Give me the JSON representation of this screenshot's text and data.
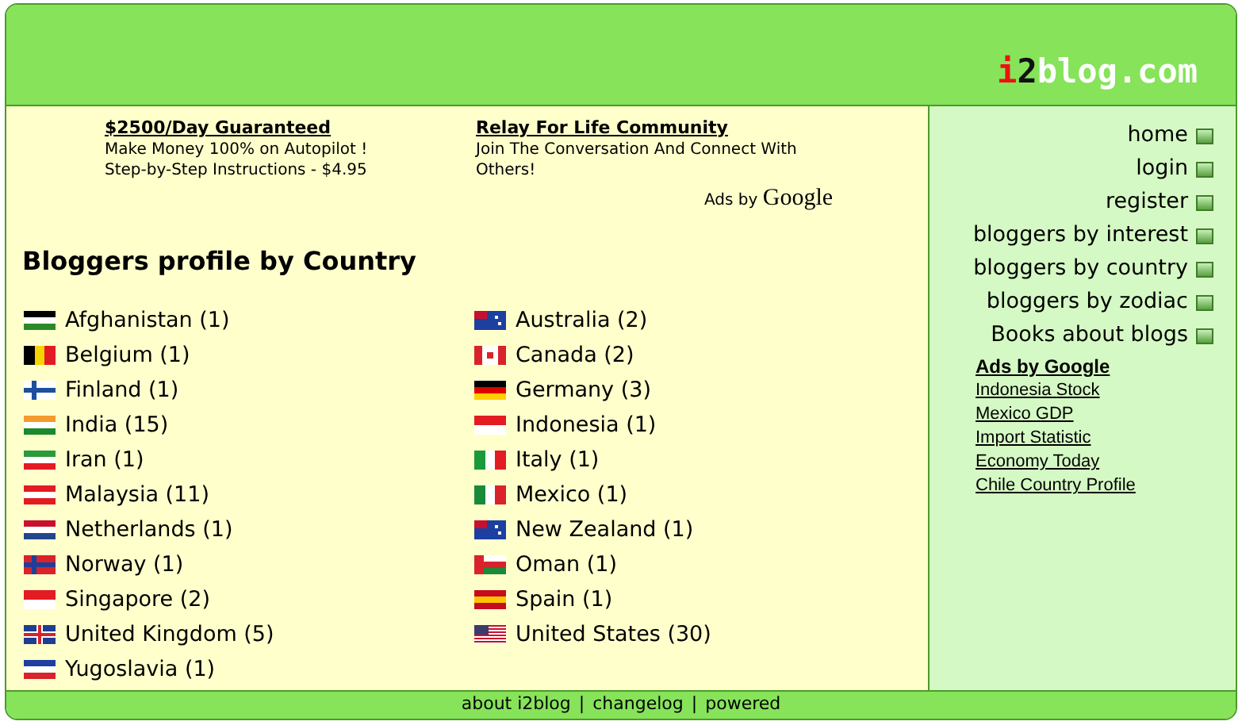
{
  "logo": {
    "parts": [
      {
        "text": "i",
        "color": "#ee1111"
      },
      {
        "text": "2",
        "color": "#111111"
      },
      {
        "text": "blog.com",
        "color": "#ffffff"
      }
    ]
  },
  "ads": [
    {
      "title": "$2500/Day Guaranteed",
      "lines": [
        "Make Money 100% on Autopilot !",
        "Step-by-Step Instructions - $4.95"
      ]
    },
    {
      "title": "Relay For Life Community",
      "lines": [
        "Join The Conversation And Connect With",
        "Others!"
      ]
    }
  ],
  "ads_by": {
    "label": "Ads by",
    "brand": "Google"
  },
  "heading": "Bloggers profile by Country",
  "countries": [
    [
      {
        "name": "Afghanistan (1)"
      },
      {
        "name": "Belgium (1)"
      },
      {
        "name": "Finland (1)"
      },
      {
        "name": "India (15)"
      },
      {
        "name": "Iran (1)"
      },
      {
        "name": "Malaysia (11)"
      },
      {
        "name": "Netherlands (1)"
      },
      {
        "name": "Norway (1)"
      },
      {
        "name": "Singapore (2)"
      },
      {
        "name": "United Kingdom (5)"
      },
      {
        "name": "Yugoslavia (1)"
      }
    ],
    [
      {
        "name": "Australia (2)"
      },
      {
        "name": "Canada (2)"
      },
      {
        "name": "Germany (3)"
      },
      {
        "name": "Indonesia (1)"
      },
      {
        "name": "Italy (1)"
      },
      {
        "name": "Mexico (1)"
      },
      {
        "name": "New Zealand (1)"
      },
      {
        "name": "Oman (1)"
      },
      {
        "name": "Spain (1)"
      },
      {
        "name": "United States (30)"
      }
    ]
  ],
  "sidebar": {
    "items": [
      "home",
      "login",
      "register",
      "bloggers by interest",
      "bloggers by country",
      "bloggers by zodiac",
      "Books about blogs"
    ],
    "ads_title": "Ads by Google",
    "ad_links": [
      "Indonesia Stock",
      "Mexico GDP",
      "Import Statistic",
      "Economy Today",
      "Chile Country Profile"
    ]
  },
  "footer": {
    "links": [
      "about i2blog",
      "changelog",
      "powered"
    ],
    "separator": "|"
  }
}
